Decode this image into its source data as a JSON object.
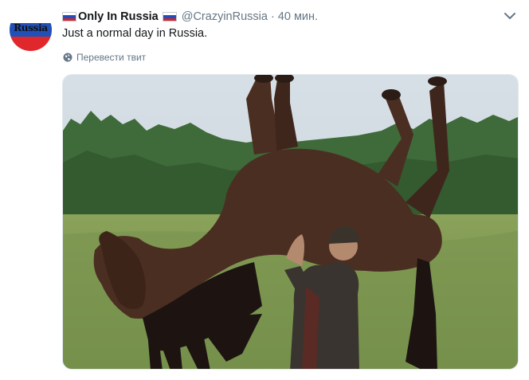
{
  "tweet": {
    "display_name": "Only In Russia",
    "handle": "@CrazyinRussia",
    "separator": "·",
    "time": "40 мин.",
    "text": "Just a normal day in Russia.",
    "translate_label": "Перевести твит",
    "avatar_text": "Russia"
  },
  "icons": {
    "flag": "russian-flag-emoji",
    "menu": "chevron-down-icon",
    "translate": "globe-icon"
  },
  "colors": {
    "secondary_text": "#657786",
    "primary_text": "#14171a",
    "flag_white": "#ffffff",
    "flag_blue": "#1f4fbf",
    "flag_red": "#d6232a"
  }
}
